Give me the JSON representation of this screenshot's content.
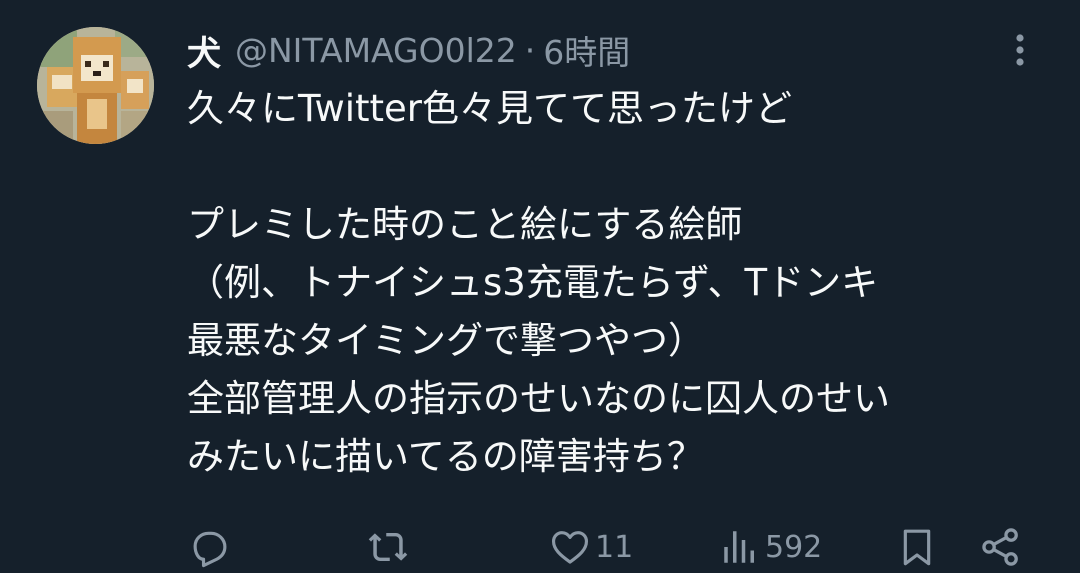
{
  "tweet": {
    "display_name": "犬",
    "handle": "@NITAMAGO0l22",
    "separator": "·",
    "time": "6時間",
    "text": "久々にTwitter色々見てて思ったけど\n\nプレミした時のこと絵にする絵師\n（例、トナイシュs3充電たらず、Tドンキ\n最悪なタイミングで撃つやつ）\n全部管理人の指示のせいなのに囚人のせい\nみたいに描いてるの障害持ち？"
  },
  "actions": {
    "reply_icon": "reply-icon",
    "retweet_icon": "retweet-icon",
    "like_icon": "heart-icon",
    "like_count": "11",
    "views_icon": "views-icon",
    "views_count": "592",
    "bookmark_icon": "bookmark-icon",
    "share_icon": "share-icon"
  },
  "colors": {
    "background": "#15202b",
    "primary_text": "#f7f9f9",
    "secondary_text": "#8b98a5"
  }
}
